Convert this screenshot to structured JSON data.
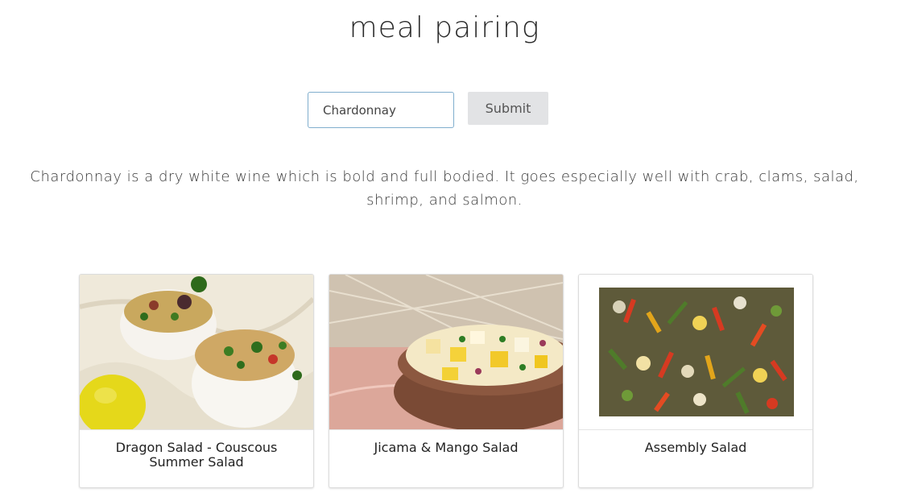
{
  "page": {
    "title": "meal pairing"
  },
  "search": {
    "value": "Chardonnay",
    "submit_label": "Submit"
  },
  "description": "Chardonnay is a dry white wine which is bold and full bodied. It goes especially well with crab, clams, salad, shrimp, and salmon.",
  "recipes": [
    {
      "title": "Dragon Salad - Couscous Summer Salad",
      "image_icon": "couscous-salad-photo"
    },
    {
      "title": "Jicama & Mango Salad",
      "image_icon": "jicama-mango-salad-photo"
    },
    {
      "title": "Assembly Salad",
      "image_icon": "assembly-salad-photo"
    }
  ],
  "colors": {
    "input_border": "#80aecd",
    "button_bg": "#e2e3e5"
  }
}
